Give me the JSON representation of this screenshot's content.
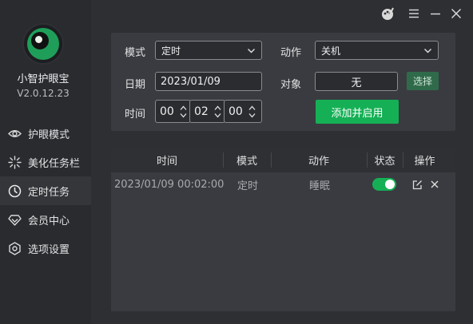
{
  "app": {
    "name": "小智护眼宝",
    "version": "V2.0.12.23"
  },
  "sidebar": {
    "items": [
      {
        "label": "护眼模式",
        "icon": "eye-icon"
      },
      {
        "label": "美化任务栏",
        "icon": "sparkle-icon"
      },
      {
        "label": "定时任务",
        "icon": "clock-icon",
        "active": true
      },
      {
        "label": "会员中心",
        "icon": "diamond-icon"
      },
      {
        "label": "选项设置",
        "icon": "gear-icon"
      }
    ]
  },
  "titlebar": {
    "icons": [
      "skin-icon",
      "menu-icon",
      "minimize-icon",
      "close-icon"
    ]
  },
  "form": {
    "mode_label": "模式",
    "mode_value": "定时",
    "action_label": "动作",
    "action_value": "关机",
    "date_label": "日期",
    "date_value": "2023/01/09",
    "target_label": "对象",
    "target_value": "无",
    "select_button": "选择",
    "time_label": "时间",
    "hour": "00",
    "minute": "02",
    "second": "00",
    "add_button": "添加并启用"
  },
  "table": {
    "headers": [
      "时间",
      "模式",
      "动作",
      "状态",
      "操作"
    ],
    "rows": [
      {
        "time": "2023/01/09 00:02:00",
        "mode": "定时",
        "action": "睡眠",
        "enabled": true
      }
    ]
  },
  "colors": {
    "accent": "#15b055",
    "sidebar_bg": "#2a2b2f",
    "panel_bg": "#3a3b40"
  }
}
